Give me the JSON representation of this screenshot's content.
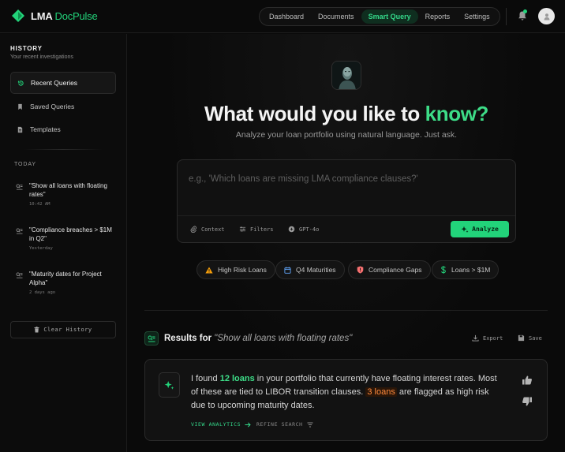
{
  "app": {
    "brand_part1": "LMA",
    "brand_part2": "DocPulse",
    "accent_color": "#22d37a"
  },
  "nav": {
    "items": [
      "Dashboard",
      "Documents",
      "Smart Query",
      "Reports",
      "Settings"
    ],
    "active": "Smart Query"
  },
  "sidebar": {
    "title": "HISTORY",
    "subtitle": "Your recent investigations",
    "items": [
      {
        "label": "Recent Queries",
        "icon": "history-icon",
        "active": true
      },
      {
        "label": "Saved Queries",
        "icon": "bookmark-icon",
        "active": false
      },
      {
        "label": "Templates",
        "icon": "document-icon",
        "active": false
      }
    ],
    "section_label": "TODAY",
    "history": [
      {
        "query": "\"Show all loans with floating rates\"",
        "time": "10:42 AM"
      },
      {
        "query": "\"Compliance breaches > $1M in Q2\"",
        "time": "Yesterday"
      },
      {
        "query": "\"Maturity dates for Project Alpha\"",
        "time": "2 days ago"
      }
    ],
    "clear_label": "Clear History"
  },
  "hero": {
    "title_prefix": "What would you like to",
    "title_accent": "know?",
    "subtitle": "Analyze your loan portfolio using natural language. Just ask."
  },
  "query": {
    "placeholder": "e.g., 'Which loans are missing LMA compliance clauses?'",
    "value": "",
    "tools": {
      "context": "Context",
      "filters": "Filters",
      "model": "GPT-4o"
    },
    "analyze_label": "Analyze"
  },
  "chips": [
    {
      "label": "High Risk Loans",
      "icon": "warning-icon",
      "color": "#f59e0b"
    },
    {
      "label": "Q4 Maturities",
      "icon": "calendar-icon",
      "color": "#60a5fa"
    },
    {
      "label": "Compliance Gaps",
      "icon": "shield-icon",
      "color": "#f87171"
    },
    {
      "label": "Loans > $1M",
      "icon": "dollar-icon",
      "color": "#22d37a"
    }
  ],
  "results": {
    "title_prefix": "Results for",
    "query": "\"Show all loans with floating rates\"",
    "export_label": "Export",
    "save_label": "Save",
    "text_1": "I found ",
    "highlight_count": "12 loans",
    "text_2": " in your portfolio that currently have floating interest rates. Most of these are tied to LIBOR transition clauses. ",
    "highlight_risk": "3 loans",
    "text_3": " are flagged as high risk due to upcoming maturity dates.",
    "view_analytics": "VIEW ANALYTICS",
    "refine_search": "REFINE SEARCH"
  }
}
